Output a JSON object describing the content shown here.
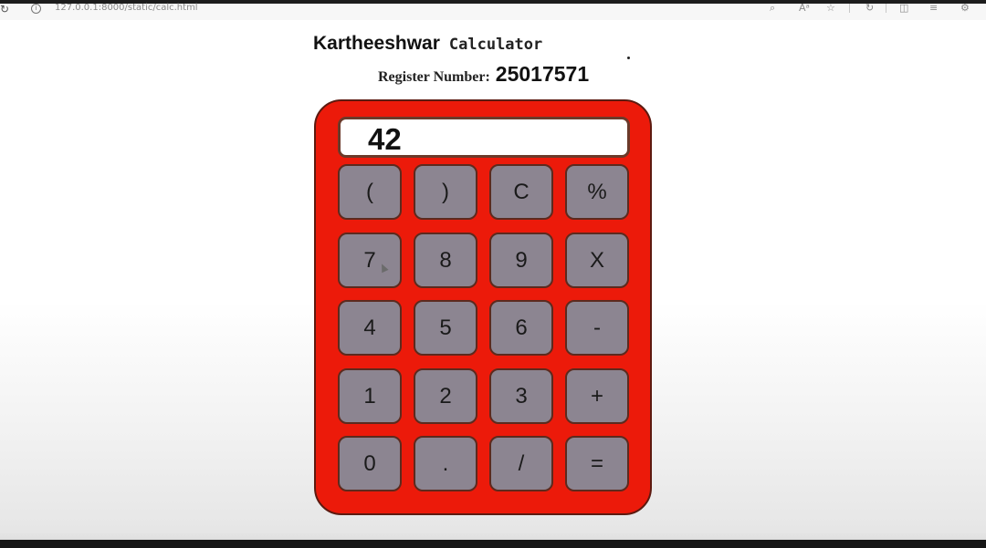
{
  "browser": {
    "url": "127.0.0.1:8000/static/calc.html",
    "icons": [
      "back-icon",
      "site-info-icon",
      "zoom-icon",
      "read-aloud-icon",
      "favorite-icon",
      "refresh-icon",
      "split-screen-icon",
      "favorites-bar-icon",
      "extensions-icon"
    ]
  },
  "header": {
    "name": "Kartheeshwar",
    "subtitle": "Calculator",
    "register_label": "Register Number:",
    "register_value": "25017571"
  },
  "calculator": {
    "display_value": "42",
    "keys": [
      [
        "(",
        ")",
        "C",
        "%"
      ],
      [
        "7",
        "8",
        "9",
        "X"
      ],
      [
        "4",
        "5",
        "6",
        "-"
      ],
      [
        "1",
        "2",
        "3",
        "+"
      ],
      [
        "0",
        ".",
        "/",
        "="
      ]
    ],
    "colors": {
      "body": "#ec1a0a",
      "key": "#8c8591",
      "display": "#ffffff"
    }
  }
}
